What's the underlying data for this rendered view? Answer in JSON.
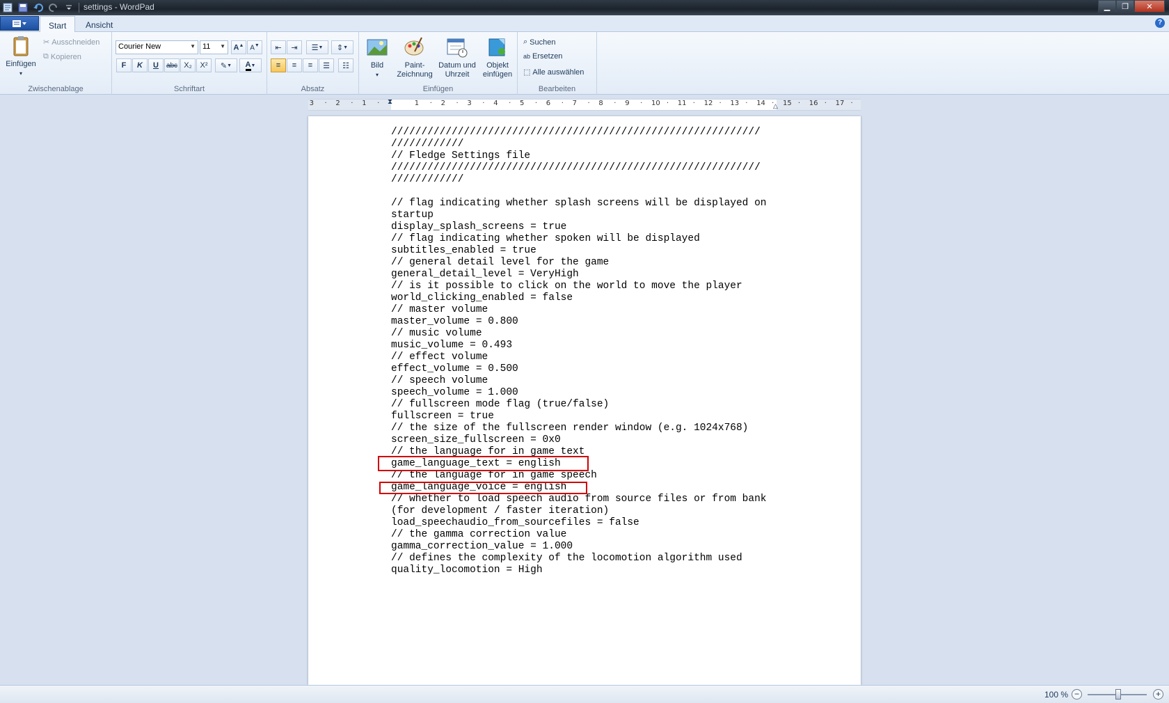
{
  "window": {
    "title": "settings - WordPad"
  },
  "tabs": [
    {
      "label": "Start"
    },
    {
      "label": "Ansicht"
    }
  ],
  "ribbon": {
    "clipboard": {
      "paste": "Einfügen",
      "cut": "Ausschneiden",
      "copy": "Kopieren",
      "group": "Zwischenablage"
    },
    "font": {
      "family": "Courier New",
      "size": "11",
      "bold": "F",
      "italic": "K",
      "underline": "U",
      "strike": "abc",
      "sub": "X₂",
      "sup": "X²",
      "group": "Schriftart"
    },
    "paragraph": {
      "group": "Absatz"
    },
    "insert": {
      "picture": "Bild",
      "paint": "Paint-\nZeichnung",
      "datetime": "Datum und\nUhrzeit",
      "object": "Objekt\neinfügen",
      "group": "Einfügen"
    },
    "edit": {
      "find": "Suchen",
      "replace": "Ersetzen",
      "selectall": "Alle auswählen",
      "group": "Bearbeiten"
    }
  },
  "ruler": {
    "ticks": [
      "3",
      "2",
      "1",
      "1",
      "2",
      "3",
      "4",
      "5",
      "6",
      "7",
      "8",
      "9",
      "10",
      "11",
      "12",
      "13",
      "14",
      "15",
      "16",
      "17"
    ]
  },
  "document": {
    "text": "/////////////////////////////////////////////////////////////\n////////////\n// Fledge Settings file\n/////////////////////////////////////////////////////////////\n////////////\n\n// flag indicating whether splash screens will be displayed on\nstartup\ndisplay_splash_screens = true\n// flag indicating whether spoken will be displayed\nsubtitles_enabled = true\n// general detail level for the game\ngeneral_detail_level = VeryHigh\n// is it possible to click on the world to move the player\nworld_clicking_enabled = false\n// master volume\nmaster_volume = 0.800\n// music volume\nmusic_volume = 0.493\n// effect volume\neffect_volume = 0.500\n// speech volume\nspeech_volume = 1.000\n// fullscreen mode flag (true/false)\nfullscreen = true\n// the size of the fullscreen render window (e.g. 1024x768)\nscreen_size_fullscreen = 0x0\n// the language for in game text\ngame_language_text = english\n// the language for in game speech\ngame_language_voice = english\n// whether to load speech audio from source files or from bank\n(for development / faster iteration)\nload_speechaudio_from_sourcefiles = false\n// the gamma correction value\ngamma_correction_value = 1.000\n// defines the complexity of the locomotion algorithm used\nquality_locomotion = High"
  },
  "status": {
    "zoom": "100 %"
  }
}
